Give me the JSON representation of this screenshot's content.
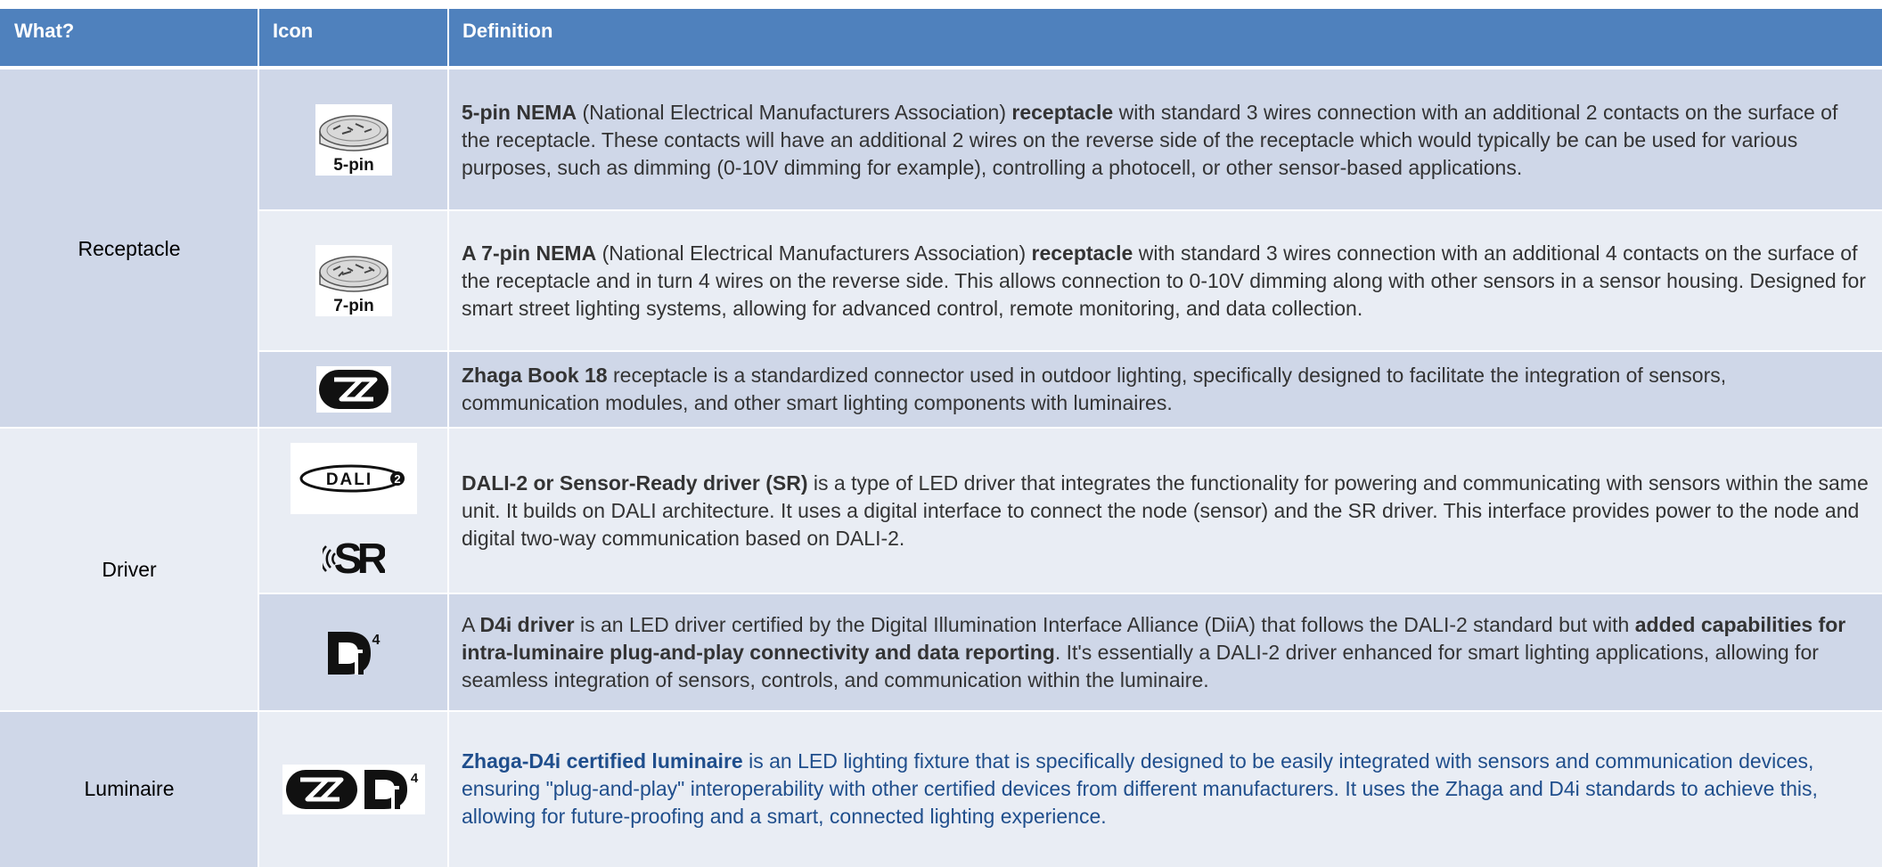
{
  "header": {
    "what": "What?",
    "icon": "Icon",
    "definition": "Definition"
  },
  "groups": {
    "receptacle": "Receptacle",
    "driver": "Driver",
    "luminaire": "Luminaire"
  },
  "icons": {
    "nema5_label": "5-pin",
    "nema7_label": "7-pin",
    "dali_label": "DALI",
    "dali_suffix": "2",
    "sr_label": "SR",
    "d4i_superscript": "4"
  },
  "rows": {
    "nema5": {
      "b1": "5-pin NEMA",
      "t1": " (National Electrical Manufacturers Association) ",
      "b2": "receptacle",
      "t2": " with standard 3 wires connection with an additional 2 contacts on the surface of the receptacle. These contacts will have an additional 2 wires on the reverse side of the receptacle which would typically be can be used for various purposes, such as dimming (0-10V dimming for example), controlling a photocell, or other sensor-based applications."
    },
    "nema7": {
      "b1": "A 7-pin NEMA",
      "t1": " (National Electrical Manufacturers Association) ",
      "b2": "receptacle",
      "t2": " with standard 3 wires connection with an additional 4 contacts on the surface of the receptacle and in turn 4 wires on the reverse side. This allows connection to 0-10V dimming along with other sensors in a sensor housing. Designed for smart street lighting systems, allowing for advanced control, remote monitoring, and data collection."
    },
    "zhaga": {
      "b1": "Zhaga Book 18",
      "t1": " receptacle is a standardized connector used in outdoor lighting, specifically designed to facilitate the integration of sensors, communication modules, and other smart lighting components with luminaires."
    },
    "dali": {
      "b1": "DALI-2 or Sensor-Ready driver (SR)",
      "t1": " is a type of LED driver that integrates the functionality for powering and communicating with sensors within the same unit. It builds on DALI architecture. It uses a digital interface to connect the node (sensor) and the SR driver. This interface provides power to the node and digital two-way communication based on DALI-2."
    },
    "d4i": {
      "t0": "A ",
      "b1": "D4i driver",
      "t1": " is an LED driver certified by the Digital Illumination Interface Alliance (DiiA) that follows the DALI-2 standard but with ",
      "b2": "added capabilities for intra-luminaire plug-and-play connectivity and data reporting",
      "t2": ". It's essentially a DALI-2 driver enhanced for smart lighting applications, allowing for seamless integration of sensors, controls, and communication within the luminaire."
    },
    "luminaire": {
      "b1": "Zhaga-D4i certified luminaire",
      "t1": " is an LED lighting fixture that is specifically designed to be easily integrated with sensors and communication devices, ensuring \"plug-and-play\" interoperability with other certified devices from different manufacturers. It uses the Zhaga and D4i standards to achieve this, allowing for future-proofing and a smart, connected lighting experience."
    }
  },
  "colors": {
    "header_bg": "#4f81bd",
    "row_dark": "#cfd7e8",
    "row_light": "#e9edf4",
    "luminaire_text": "#1f4e8c"
  }
}
